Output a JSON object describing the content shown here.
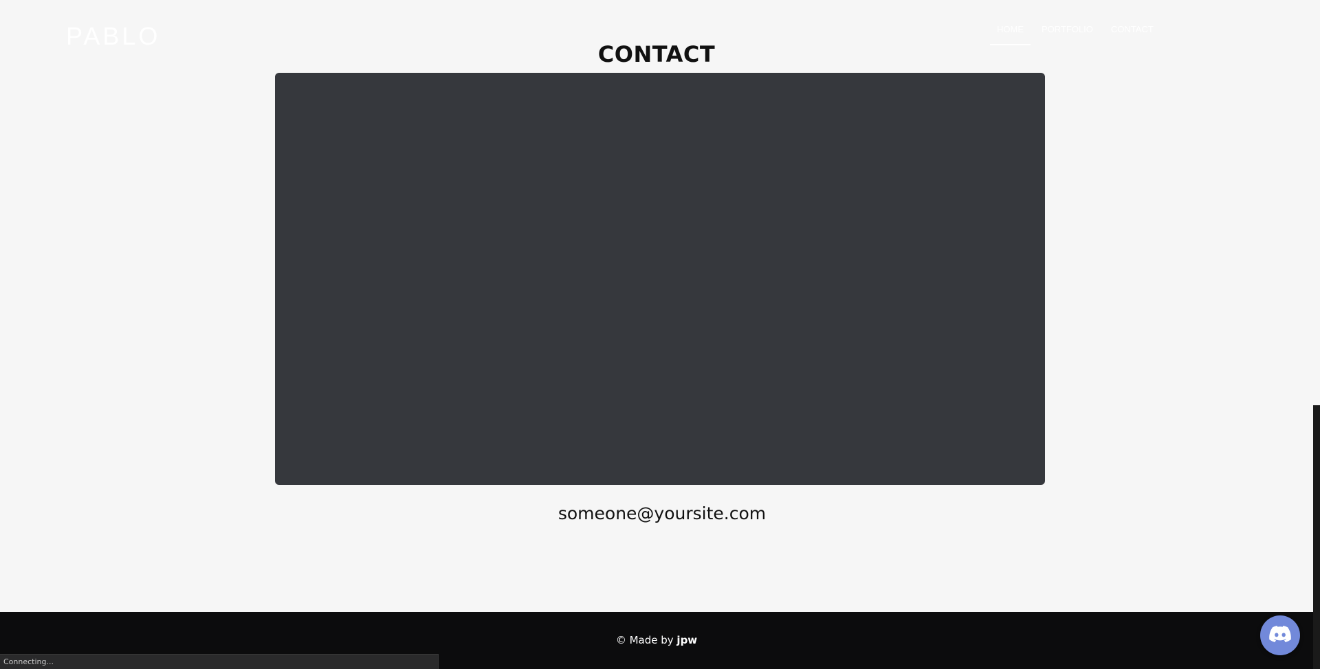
{
  "header": {
    "logo": "PABLO",
    "nav": [
      {
        "label": "HOME",
        "active": true
      },
      {
        "label": "PORTFOLIO",
        "active": false
      },
      {
        "label": "CONTACT",
        "active": false
      }
    ]
  },
  "main": {
    "title": "CONTACT",
    "email": "someone@yoursite.com"
  },
  "footer": {
    "prefix": "© Made by ",
    "author": "jpw"
  },
  "discord": {
    "icon": "discord-icon",
    "color": "#7289da"
  },
  "status": {
    "text": "Connecting..."
  },
  "colors": {
    "background": "#f6f6f6",
    "panel": "#36383d",
    "footer": "#0c0c0d"
  }
}
